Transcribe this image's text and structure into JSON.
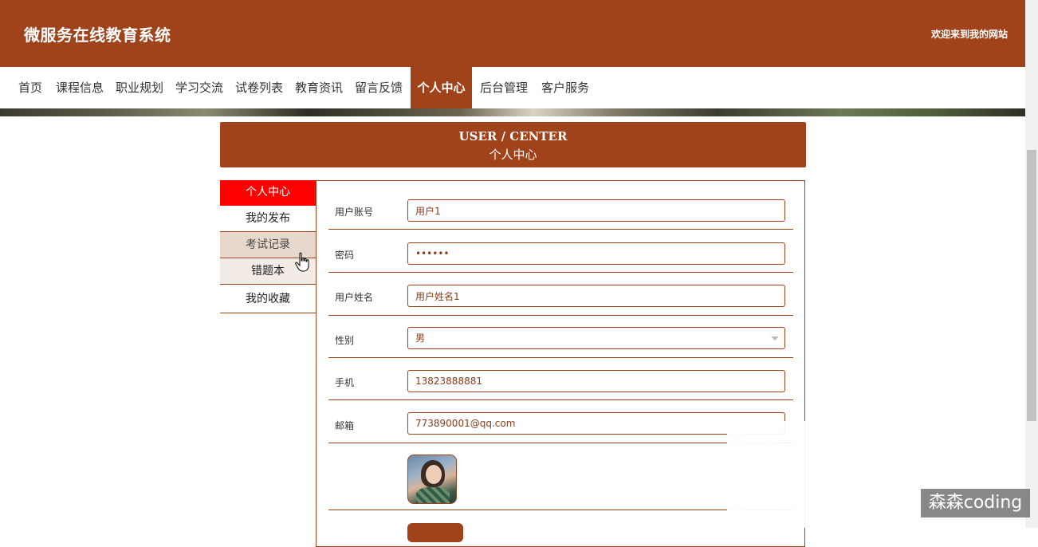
{
  "header": {
    "site_title": "微服务在线教育系统",
    "welcome": "欢迎来到我的网站"
  },
  "nav": {
    "items": [
      {
        "label": "首页"
      },
      {
        "label": "课程信息"
      },
      {
        "label": "职业规划"
      },
      {
        "label": "学习交流"
      },
      {
        "label": "试卷列表"
      },
      {
        "label": "教育资讯"
      },
      {
        "label": "留言反馈"
      },
      {
        "label": "个人中心",
        "active": true
      },
      {
        "label": "后台管理"
      },
      {
        "label": "客户服务"
      }
    ]
  },
  "center_heading": {
    "en": "USER / CENTER",
    "cn": "个人中心"
  },
  "side_menu": {
    "items": [
      {
        "label": "个人中心",
        "state": "active"
      },
      {
        "label": "我的发布"
      },
      {
        "label": "考试记录",
        "state": "hover"
      },
      {
        "label": "错题本"
      },
      {
        "label": "我的收藏"
      }
    ]
  },
  "form": {
    "fields": [
      {
        "label": "用户账号",
        "value": "用户1"
      },
      {
        "label": "密码",
        "value": "••••••"
      },
      {
        "label": "用户姓名",
        "value": "用户姓名1"
      },
      {
        "label": "性别",
        "value": "男"
      },
      {
        "label": "手机",
        "value": "13823888881"
      },
      {
        "label": "邮箱",
        "value": "773890001@qq.com"
      }
    ]
  },
  "watermark": "森森coding",
  "colors": {
    "brand": "#a0421a",
    "active_menu": "#ff0000"
  }
}
